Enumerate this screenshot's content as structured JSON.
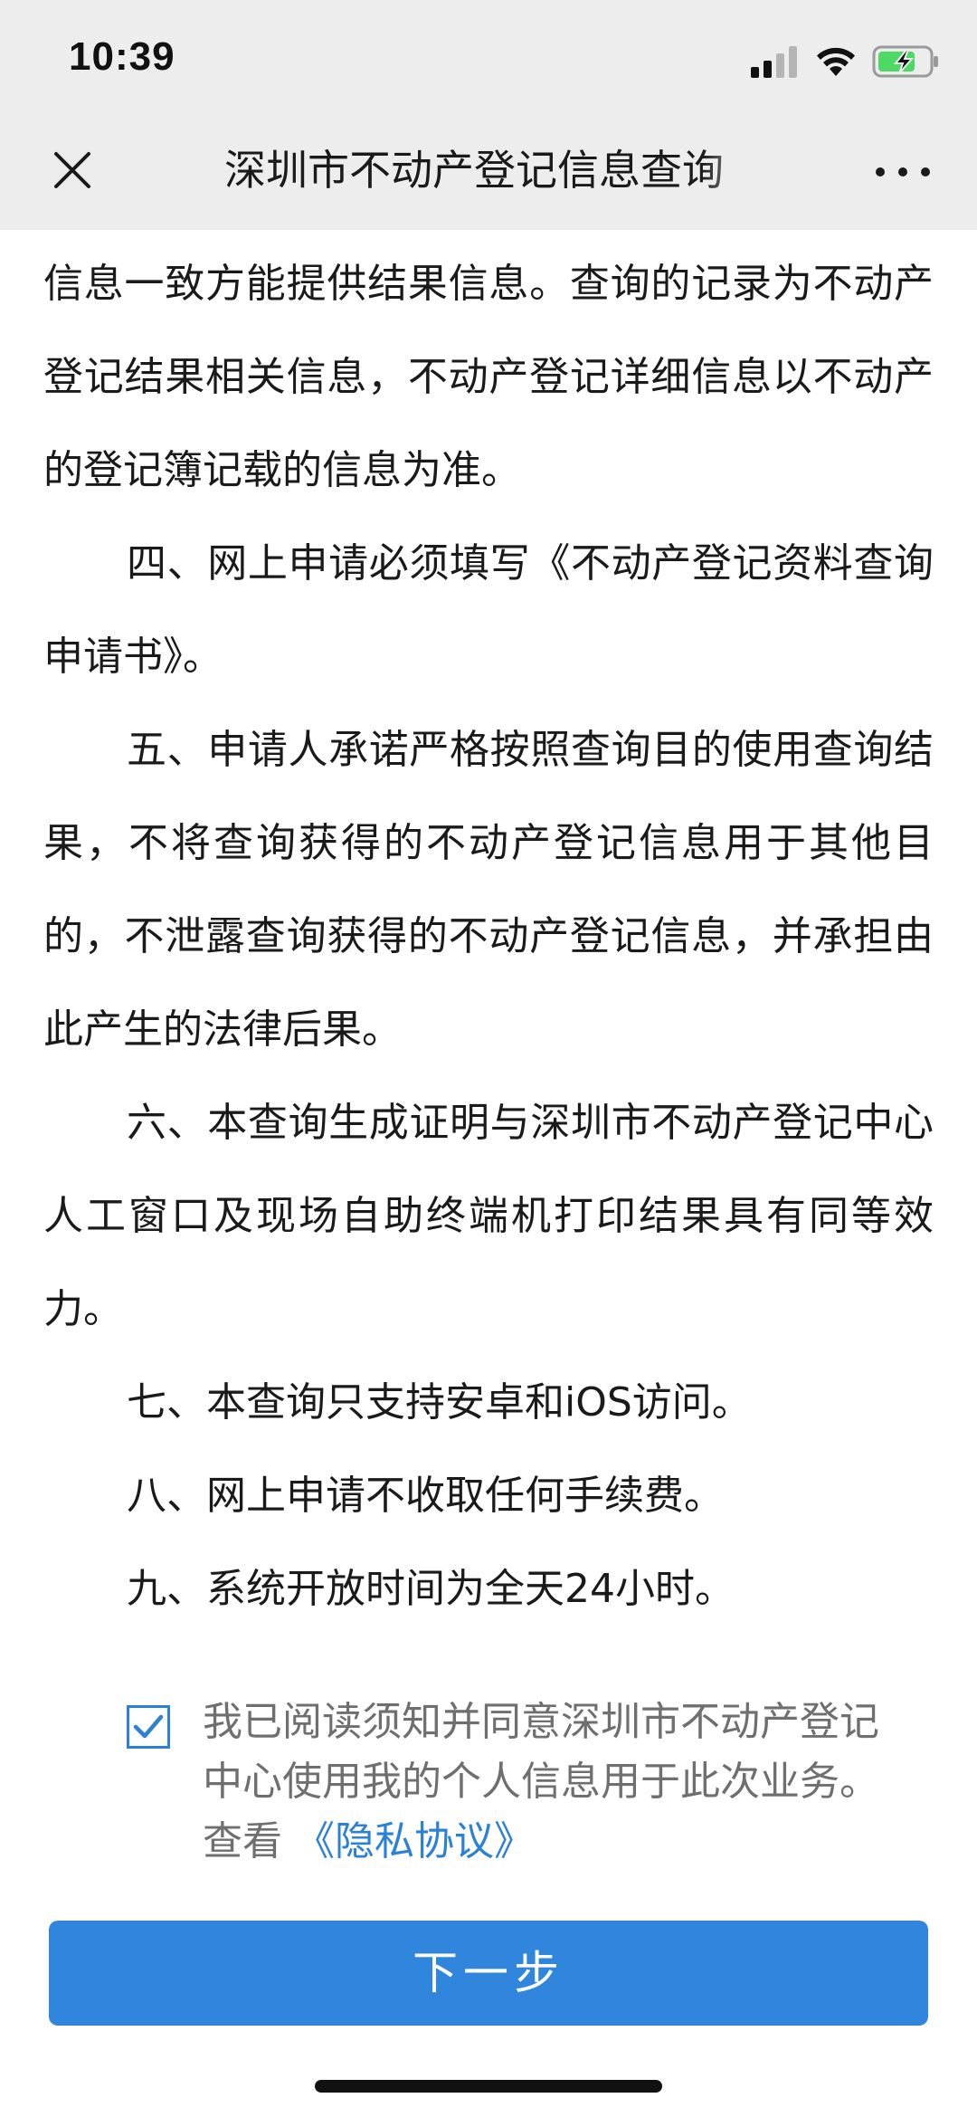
{
  "status_bar": {
    "time": "10:39"
  },
  "nav": {
    "title": "深圳市不动产登记信息查询"
  },
  "content": {
    "paragraphs": [
      "信息一致方能提供结果信息。查询的记录为不动产登记结果相关信息，不动产登记详细信息以不动产的登记簿记载的信息为准。",
      "四、网上申请必须填写《不动产登记资料查询申请书》。",
      "五、申请人承诺严格按照查询目的使用查询结果，不将查询获得的不动产登记信息用于其他目的，不泄露查询获得的不动产登记信息，并承担由此产生的法律后果。",
      "六、本查询生成证明与深圳市不动产登记中心人工窗口及现场自助终端机打印结果具有同等效力。",
      "七、本查询只支持安卓和iOS访问。",
      "八、网上申请不收取任何手续费。",
      "九、系统开放时间为全天24小时。"
    ]
  },
  "agreement": {
    "checked": true,
    "text": "我已阅读须知并同意深圳市不动产登记中心使用我的个人信息用于此次业务。查看",
    "link": "《隐私协议》"
  },
  "next_button": {
    "label": "下一步"
  },
  "colors": {
    "accent": "#2f86dc",
    "link": "#2b80d8",
    "nav_bg": "#ededed"
  }
}
